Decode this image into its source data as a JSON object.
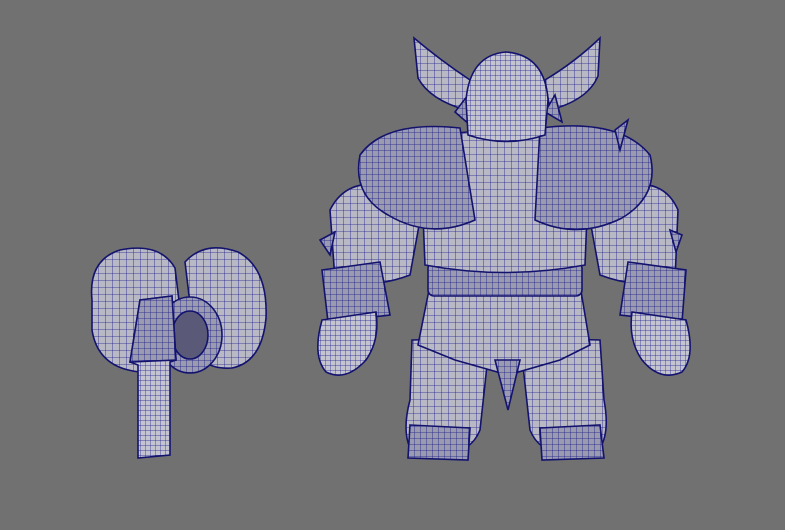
{
  "viewport": {
    "background": "#717171",
    "wire_color": "#1a1a8c",
    "surface_color": "#b9b9c6",
    "surface_shadow": "#8f8fa6"
  },
  "models": [
    {
      "name": "hammer-weapon-model"
    },
    {
      "name": "armored-warrior-back-model"
    }
  ]
}
